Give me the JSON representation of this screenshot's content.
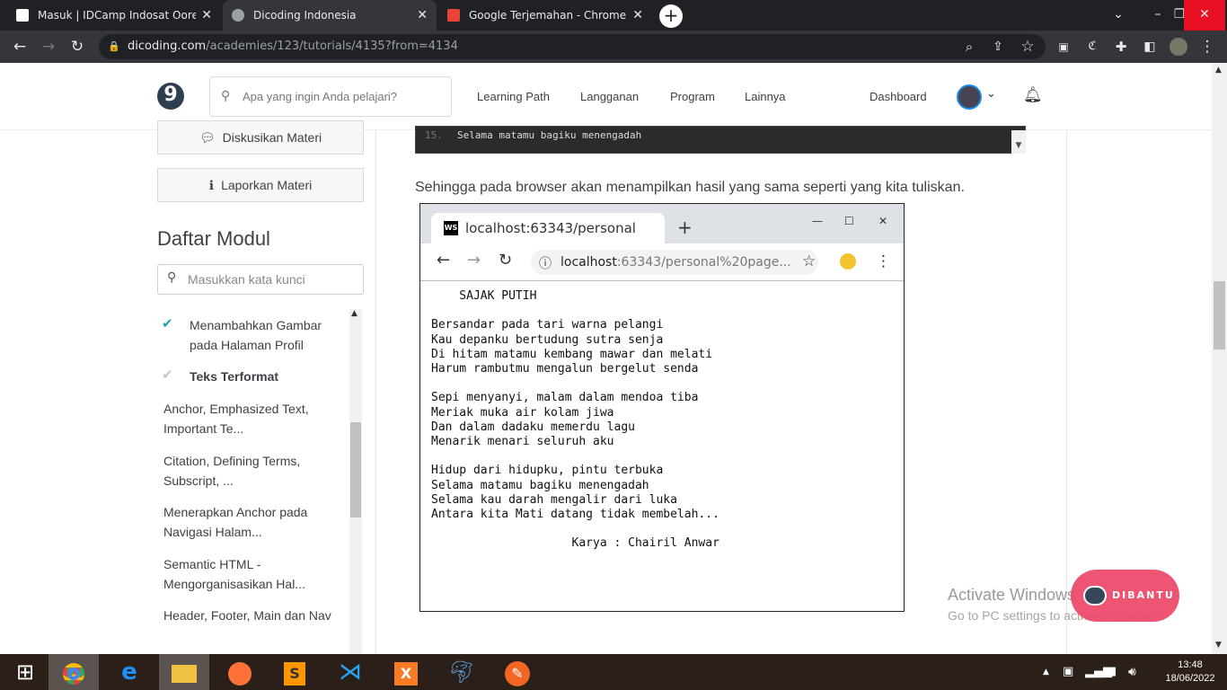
{
  "browser": {
    "tabs": [
      {
        "title": "Masuk | IDCamp Indosat Ooredoo",
        "active": false
      },
      {
        "title": "Dicoding Indonesia",
        "active": true
      },
      {
        "title": "Google Terjemahan - Chrome Web",
        "active": false
      }
    ],
    "url_host": "dicoding.com",
    "url_path": "/academies/123/tutorials/4135?from=4134"
  },
  "header": {
    "logo": "9",
    "search_placeholder": "Apa yang ingin Anda pelajari?",
    "nav": [
      "Learning Path",
      "Langganan",
      "Program",
      "Lainnya"
    ],
    "dashboard": "Dashboard"
  },
  "sidebar": {
    "discuss_button": "Diskusikan Materi",
    "report_button": "Laporkan Materi",
    "module_heading": "Daftar Modul",
    "keyword_placeholder": "Masukkan kata kunci",
    "modules": [
      {
        "label": "Menambahkan Gambar pada Halaman Profil",
        "checked": true
      },
      {
        "label": "Teks Terformat",
        "checked": false
      },
      {
        "label": "Anchor, Emphasized Text, Important Te...",
        "checked": false
      },
      {
        "label": "Citation, Defining Terms, Subscript, ...",
        "checked": false
      },
      {
        "label": "Menerapkan Anchor pada Navigasi Halam...",
        "checked": false
      },
      {
        "label": "Semantic HTML - Mengorganisasikan Hal...",
        "checked": false
      },
      {
        "label": "Header, Footer, Main dan Nav",
        "checked": false
      }
    ]
  },
  "content": {
    "code_line_number": "15.",
    "code_line": "Selama matamu bagiku menengadah",
    "paragraph": "Sehingga pada browser akan menampilkan hasil yang sama seperti yang kita tuliskan.",
    "screenshot": {
      "tab_title": "localhost:63343/personal",
      "url_host": "localhost",
      "url_rest": ":63343/personal%20page...",
      "poem": "    SAJAK PUTIH\n\nBersandar pada tari warna pelangi\nKau depanku bertudung sutra senja\nDi hitam matamu kembang mawar dan melati\nHarum rambutmu mengalun bergelut senda\n\nSepi menyanyi, malam dalam mendoa tiba\nMeriak muka air kolam jiwa\nDan dalam dadaku memerdu lagu\nMenarik menari seluruh aku\n\nHidup dari hidupku, pintu terbuka\nSelama matamu bagiku menengadah\nSelama kau darah mengalir dari luka\nAntara kita Mati datang tidak membelah...\n\n                    Karya : Chairil Anwar"
    }
  },
  "overlay": {
    "watermark_title": "Activate Windows",
    "watermark_sub": "Go to PC settings to activate Windows.",
    "help_button": "DIBANTU"
  },
  "taskbar": {
    "time": "13:48",
    "date": "18/06/2022"
  }
}
